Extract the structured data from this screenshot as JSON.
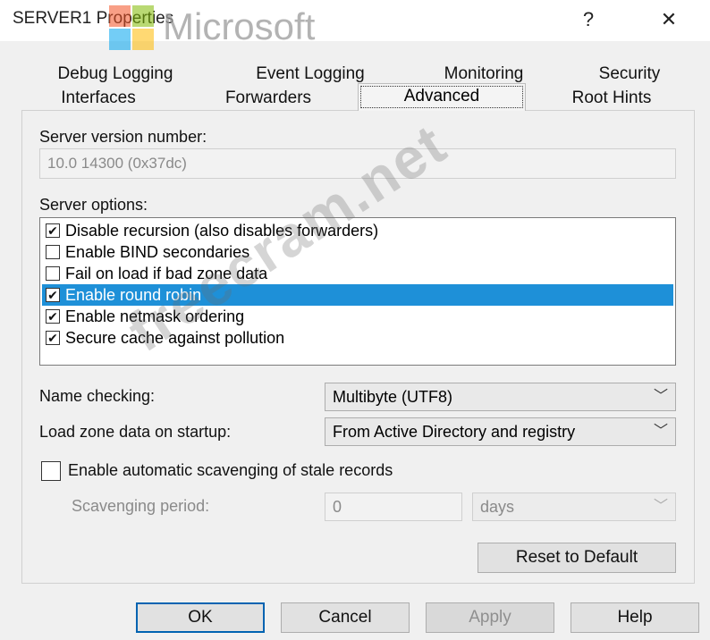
{
  "window": {
    "title": "SERVER1 Properties",
    "help_glyph": "?",
    "close_glyph": "✕"
  },
  "branding": {
    "logo_word": "Microsoft",
    "logo_colors": [
      "#f25022",
      "#7fba00",
      "#00a4ef",
      "#ffb900"
    ]
  },
  "tabs": {
    "row1": [
      "Debug Logging",
      "Event Logging",
      "Monitoring",
      "Security"
    ],
    "row2": [
      "Interfaces",
      "Forwarders",
      "Advanced",
      "Root Hints"
    ],
    "active": "Advanced"
  },
  "advanced": {
    "version_label": "Server version number:",
    "version_value": "10.0 14300 (0x37dc)",
    "options_label": "Server options:",
    "options": [
      {
        "label": "Disable recursion (also disables forwarders)",
        "checked": true,
        "selected": false
      },
      {
        "label": "Enable BIND secondaries",
        "checked": false,
        "selected": false
      },
      {
        "label": "Fail on load if bad zone data",
        "checked": false,
        "selected": false
      },
      {
        "label": "Enable round robin",
        "checked": true,
        "selected": true
      },
      {
        "label": "Enable netmask ordering",
        "checked": true,
        "selected": false
      },
      {
        "label": "Secure cache against pollution",
        "checked": true,
        "selected": false
      }
    ],
    "name_checking_label": "Name checking:",
    "name_checking_value": "Multibyte (UTF8)",
    "load_zone_label": "Load zone data on startup:",
    "load_zone_value": "From Active Directory and registry",
    "scavenging_label": "Enable automatic scavenging of stale records",
    "scavenging_checked": false,
    "period_label": "Scavenging period:",
    "period_value": "0",
    "period_unit": "days",
    "reset_label": "Reset to Default",
    "check_glyph": "✔",
    "dropdown_glyph": "﹀"
  },
  "footer": {
    "ok": "OK",
    "cancel": "Cancel",
    "apply": "Apply",
    "help": "Help"
  },
  "watermark": "freecram.net",
  "colors": {
    "selection": "#1e90d8",
    "default_button_border": "#0063b1"
  }
}
